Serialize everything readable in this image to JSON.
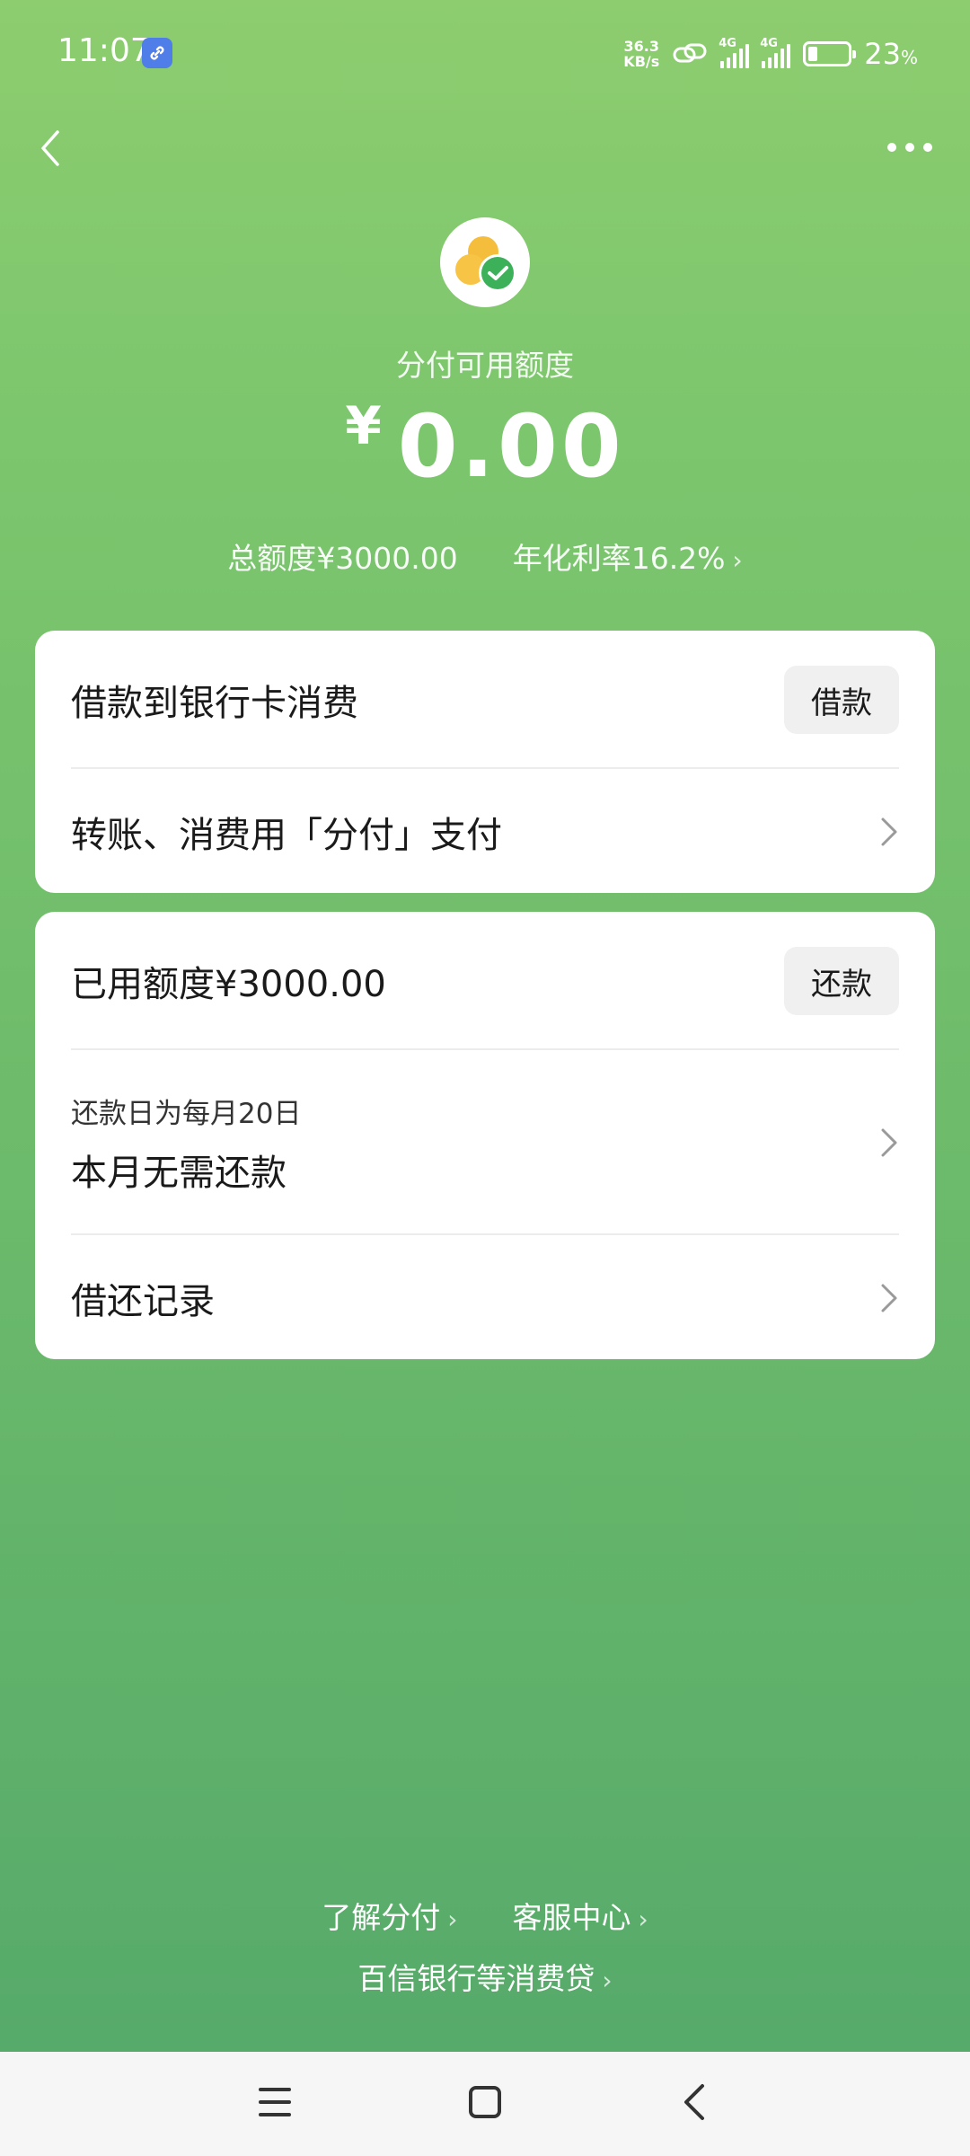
{
  "status_bar": {
    "time": "11:07",
    "net_speed_value": "36.3",
    "net_speed_unit": "KB/s",
    "signal1_type": "4G",
    "signal2_type": "4G",
    "battery_percent": "23",
    "battery_percent_sign": "%",
    "battery_level": 0.23
  },
  "header": {
    "credit_label": "分付可用额度",
    "currency_symbol": "¥",
    "available_amount": "0.00",
    "total_limit": "总额度¥3000.00",
    "annual_rate": "年化利率16.2%"
  },
  "card_borrow": {
    "borrow_text": "借款到银行卡消费",
    "borrow_button": "借款",
    "pay_text": "转账、消费用「分付」支付"
  },
  "card_repay": {
    "used_text": "已用额度¥3000.00",
    "repay_button": "还款",
    "due_day_text": "还款日为每月20日",
    "due_status": "本月无需还款",
    "records_text": "借还记录"
  },
  "footer": {
    "learn_link": "了解分付",
    "service_link": "客服中心",
    "lender_link": "百信银行等消费贷"
  },
  "colors": {
    "accent_green": "#7cc66d",
    "logo_yellow": "#f5bd3c",
    "logo_check_green": "#3cb15a"
  },
  "icons": [
    "link-icon",
    "hotspot-link-icon",
    "back-icon",
    "more-icon",
    "fenfu-logo-icon",
    "chevron-right-icon",
    "menu-icon",
    "home-icon",
    "back-nav-icon"
  ]
}
